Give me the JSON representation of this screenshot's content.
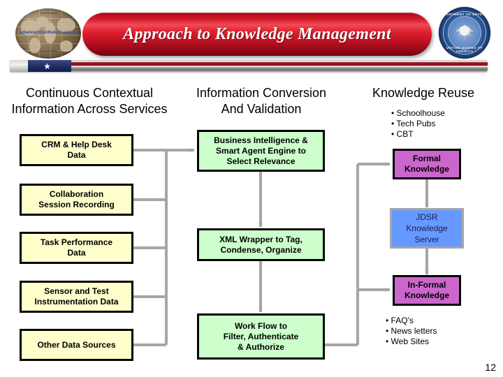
{
  "slide": {
    "title": "Approach to Knowledge Management",
    "page_number": "12",
    "logo_left": {
      "name": "advanced-distributed-learning-globe-logo",
      "caption": "Advanced Distributed\nLearning",
      "micro_top": "Joint Services",
      "micro_bottom": "Interoperability"
    },
    "logo_right": {
      "name": "department-of-defense-seal",
      "top_text": "DEPARTMENT OF DEFENSE",
      "bottom_text": "UNITED STATES OF AMERICA"
    },
    "colors": {
      "title_banner_red": "#cf1626",
      "source_box": "#ffffcc",
      "process_box": "#ccffcc",
      "knowledge_box": "#cc66cc",
      "server_box": "#6699ff",
      "connector": "#a6a6a6",
      "border": "#000000"
    }
  },
  "columns": {
    "left": {
      "heading": "Continuous Contextual\nInformation Across Services"
    },
    "middle": {
      "heading": "Information Conversion\nAnd Validation"
    },
    "right": {
      "heading": "Knowledge Reuse"
    }
  },
  "bullets": {
    "knowledge_reuse": [
      "• Schoolhouse",
      "• Tech Pubs",
      "• CBT"
    ],
    "informal_knowledge": [
      "• FAQ's",
      "• News letters",
      "• Web Sites"
    ]
  },
  "boxes": {
    "sources": [
      {
        "label": "CRM & Help Desk\nData"
      },
      {
        "label": "Collaboration\nSession Recording"
      },
      {
        "label": "Task Performance\nData"
      },
      {
        "label": "Sensor and Test\nInstrumentation Data"
      },
      {
        "label": "Other Data Sources"
      }
    ],
    "processes": [
      {
        "label": "Business Intelligence &\nSmart Agent Engine to\nSelect Relevance"
      },
      {
        "label": "XML Wrapper to Tag,\nCondense, Organize"
      },
      {
        "label": "Work Flow to\nFilter, Authenticate\n& Authorize"
      }
    ],
    "outputs": [
      {
        "label": "Formal\nKnowledge"
      },
      {
        "label": "JDSR\nKnowledge\nServer"
      },
      {
        "label": "In-Formal\nKnowledge"
      }
    ]
  }
}
